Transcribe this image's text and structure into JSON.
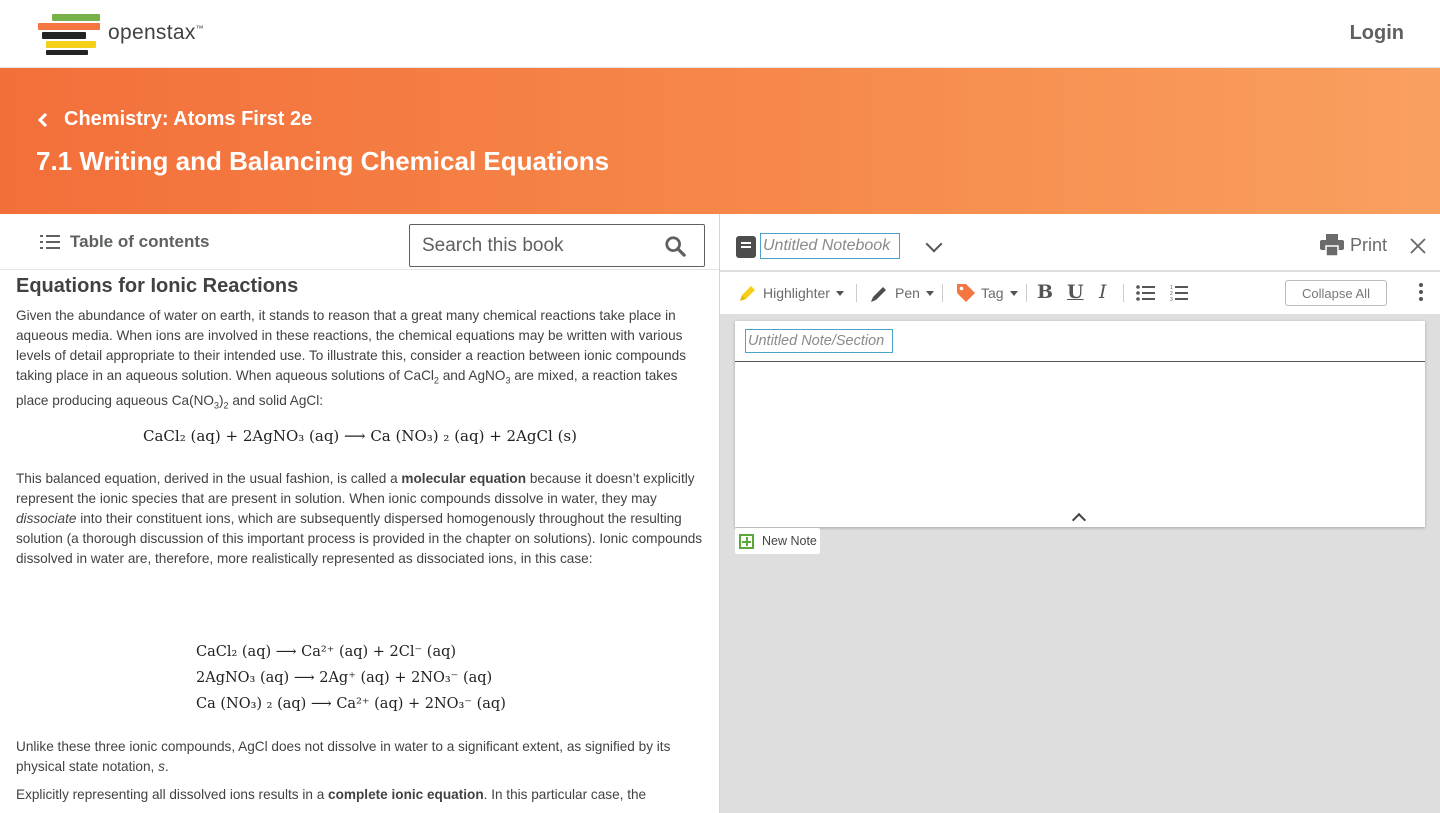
{
  "nav": {
    "brand": "openstax",
    "tm": "™",
    "login_label": "Login"
  },
  "hero": {
    "book_title": "Chemistry: Atoms First 2e",
    "section_title": "7.1 Writing and Balancing Chemical Equations"
  },
  "toolbar": {
    "toc_label": "Table of contents",
    "search_placeholder": "Search this book"
  },
  "content": {
    "heading": "Equations for Ionic Reactions",
    "p1_a": "Given the abundance of water on earth, it stands to reason that a great many chemical reactions take place in aqueous media. When ions are involved in these reactions, the chemical equations may be written with various levels of detail appropriate to their intended use. To illustrate this, consider a reaction between ionic compounds taking place in an aqueous solution. When aqueous solutions of CaCl",
    "p1_b": "2",
    "p1_c": " and AgNO",
    "p1_d": "3",
    "p1_e": " are mixed, a reaction takes place producing aqueous Ca(NO",
    "p1_f": "3",
    "p1_g": ")",
    "p1_h": "2",
    "p1_i": " and solid AgCl:",
    "eq_molecular": "CaCl₂ (aq) + 2AgNO₃ (aq)  ⟶  Ca (NO₃) ₂ (aq) + 2AgCl (s)",
    "p2_a": "This balanced equation, derived in the usual fashion, is called a ",
    "p2_bold": "molecular equation",
    "p2_b": " because it doesn’t explicitly represent the ionic species that are present in solution. When ionic compounds dissolve in water, they may ",
    "p2_ital": "dissociate",
    "p2_c": " into their constituent ions, which are subsequently dispersed homogenously throughout the resulting solution (a thorough discussion of this important process is provided in the chapter on solutions). Ionic compounds dissolved in water are, therefore, more realistically represented as dissociated ions, in this case:",
    "eq_lines": [
      "CaCl₂ (aq)  ⟶  Ca²⁺ (aq) + 2Cl⁻ (aq)",
      "2AgNO₃ (aq)  ⟶  2Ag⁺ (aq) + 2NO₃⁻ (aq)",
      "Ca (NO₃) ₂ (aq)  ⟶  Ca²⁺ (aq) + 2NO₃⁻ (aq)"
    ],
    "p3_a": "Unlike these three ionic compounds, AgCl does not dissolve in water to a significant extent, as signified by its physical state notation, ",
    "p3_ital": "s",
    "p3_b": ".",
    "p4_a": "Explicitly representing all dissolved ions results in a ",
    "p4_bold": "complete ionic equation",
    "p4_b": ". In this particular case, the"
  },
  "notebook": {
    "title_placeholder": "Untitled Notebook",
    "print_label": "Print",
    "highlighter_label": "Highlighter",
    "pen_label": "Pen",
    "tag_label": "Tag",
    "bold_label": "B",
    "underline_label": "U",
    "italic_label": "I",
    "collapse_label": "Collapse All",
    "note_placeholder": "Untitled Note/Section",
    "new_note_label": "New Note"
  },
  "colors": {
    "brand_orange": "#f36f3a",
    "highlighter": "#f4d019",
    "tag": "#f47641",
    "new_note_green": "#5aa83a"
  }
}
